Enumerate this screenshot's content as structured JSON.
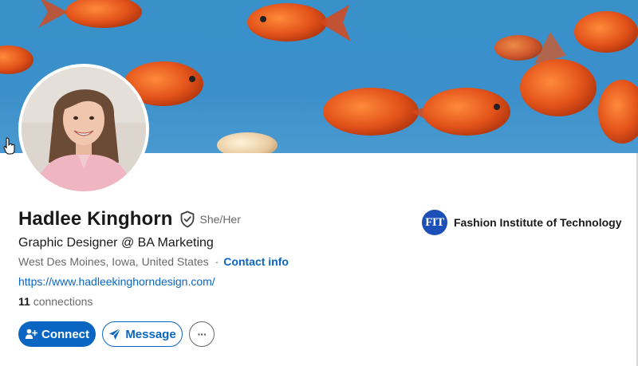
{
  "profile": {
    "name": "Hadlee Kinghorn",
    "pronouns": "She/Her",
    "headline": "Graphic Designer @ BA Marketing",
    "location": "West Des Moines, Iowa, United States",
    "separator": "·",
    "contact_info_label": "Contact info",
    "website": "https://www.hadleekinghorndesign.com/",
    "connections_count": "11",
    "connections_label": "connections"
  },
  "education": {
    "logo_text": "FIT",
    "school_name": "Fashion Institute of Technology"
  },
  "actions": {
    "connect_label": "Connect",
    "message_label": "Message",
    "more_label": "···"
  },
  "colors": {
    "accent": "#0a66c2",
    "banner_sky": "#3b8fca",
    "goldfish": "#e2521a",
    "school_logo": "#1c4fb7"
  },
  "icons": {
    "verified": "shield-check-icon",
    "connect": "person-plus-icon",
    "message": "paper-plane-icon",
    "more": "ellipsis-icon",
    "cursor": "hand-pointer-icon"
  }
}
